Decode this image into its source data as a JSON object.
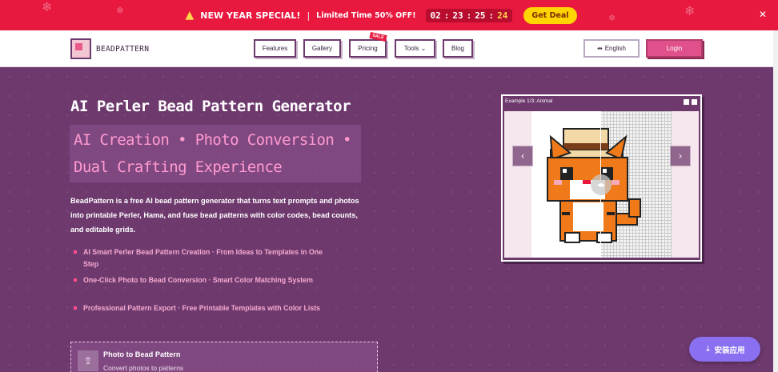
{
  "promo": {
    "title": "NEW YEAR SPECIAL!",
    "separator": "|",
    "subtitle": "Limited Time 50% OFF!",
    "timer": {
      "hours": "02",
      "minutes": "23",
      "seconds": "25",
      "centis": "24",
      "colon": ":"
    },
    "cta": "Get Deal",
    "close": "✕"
  },
  "nav": {
    "brand": "BEADPATTERN",
    "items": [
      {
        "label": "Features"
      },
      {
        "label": "Gallery"
      },
      {
        "label": "Pricing",
        "badge": "SALE"
      },
      {
        "label": "Tools ⌄"
      },
      {
        "label": "Blog"
      }
    ],
    "language": "English",
    "login": "Login"
  },
  "hero": {
    "title": "AI Perler Bead Pattern Generator",
    "tagline_line1": "AI Creation  •  Photo Conversion  •",
    "tagline_line2": "Dual Crafting Experience",
    "description": "BeadPattern is a free AI bead pattern generator that turns text prompts and photos into printable Perler, Hama, and fuse bead patterns with color codes, bead counts, and editable grids.",
    "features": [
      "AI Smart Perler Bead Pattern Creation · From Ideas to Templates in One Step",
      "One-Click Photo to Bead Conversion · Smart Color Matching System",
      "Professional Pattern Export · Free Printable Templates with Color Lists"
    ],
    "upload": {
      "title": "Photo to Bead Pattern",
      "subtitle": "Convert photos to patterns"
    }
  },
  "example": {
    "label": "Example 1/3: Animal",
    "prev": "‹",
    "next": "›"
  },
  "install": {
    "label": "安装应用"
  },
  "colors": {
    "promo_bg": "#e8183f",
    "hero_bg": "#6e3a6e",
    "accent_pink": "#ff9ad1",
    "login_bg": "#e0508a",
    "install_bg": "#8a6ff0"
  }
}
